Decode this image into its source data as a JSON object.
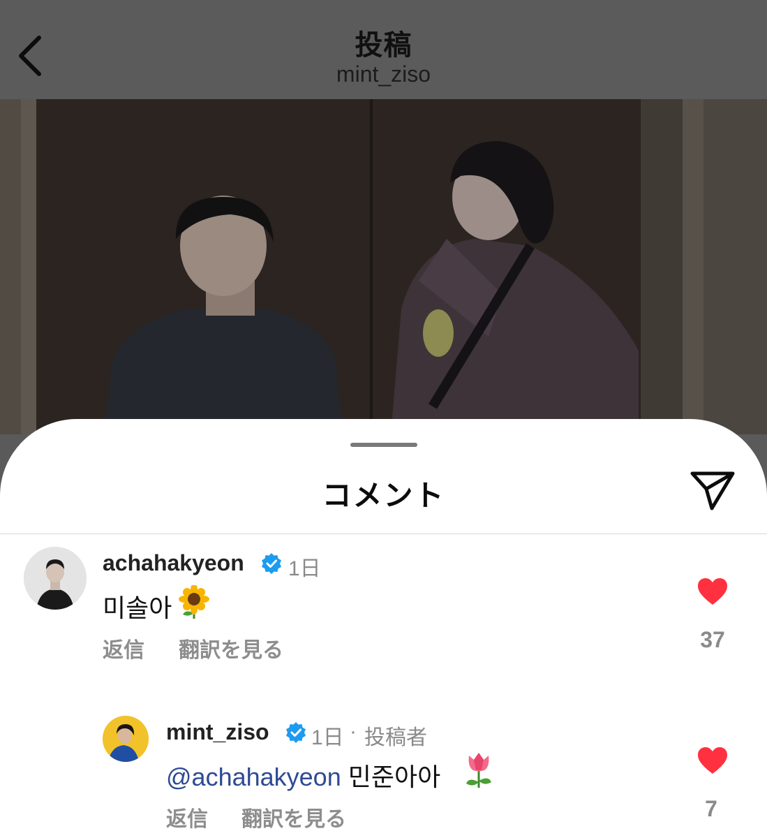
{
  "header": {
    "title": "投稿",
    "subtitle": "mint_ziso"
  },
  "sheet": {
    "title": "コメント"
  },
  "comments": [
    {
      "username": "achahakyeon",
      "time": "1日",
      "text": "미솔아",
      "emoji": "sunflower-emoji",
      "reply_label": "返信",
      "translate_label": "翻訳を見る",
      "likes": "37"
    },
    {
      "username": "mint_ziso",
      "time": "1日",
      "separator": "·",
      "author_badge": "投稿者",
      "mention": "@achahakyeon",
      "text": "민준아아",
      "emoji": "tulip-emoji",
      "reply_label": "返信",
      "translate_label": "翻訳を見る",
      "likes": "7"
    }
  ],
  "colors": {
    "overlay": "#5b5b5b",
    "heart": "#ff3040",
    "verified": "#1d9bf0",
    "mention": "#2e4a93",
    "meta": "#8a8a8a"
  }
}
